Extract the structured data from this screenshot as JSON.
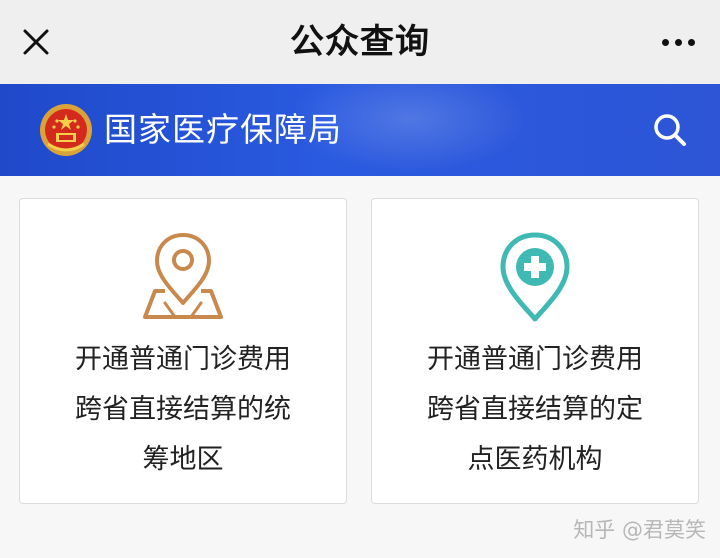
{
  "topbar": {
    "title": "公众查询",
    "close_icon": "close-icon",
    "more_icon": "more-dots-icon"
  },
  "banner": {
    "agency_name": "国家医疗保障局",
    "emblem_icon": "national-emblem-icon",
    "search_icon": "search-icon",
    "colors": {
      "background": "#2a5ae0",
      "text": "#ffffff"
    }
  },
  "cards": [
    {
      "icon": "map-pin-icon",
      "icon_color": "#c9894d",
      "label_lines": [
        "开通普通门诊费用",
        "跨省直接结算的统",
        "筹地区"
      ]
    },
    {
      "icon": "medical-location-icon",
      "icon_color": "#3fb9b3",
      "label_lines": [
        "开通普通门诊费用",
        "跨省直接结算的定",
        "点医药机构"
      ]
    }
  ],
  "watermark": "知乎 @君莫笑"
}
